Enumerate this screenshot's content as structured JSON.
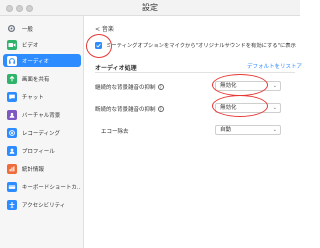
{
  "window": {
    "title": "設定"
  },
  "sidebar": {
    "items": [
      {
        "label": "一般",
        "icon": "gear-icon",
        "active": false
      },
      {
        "label": "ビデオ",
        "icon": "video-icon",
        "active": false
      },
      {
        "label": "オーディオ",
        "icon": "headphones-icon",
        "active": true
      },
      {
        "label": "画面を共有",
        "icon": "screen-share-icon",
        "active": false
      },
      {
        "label": "チャット",
        "icon": "chat-icon",
        "active": false
      },
      {
        "label": "バーチャル背景",
        "icon": "background-icon",
        "active": false
      },
      {
        "label": "レコーディング",
        "icon": "record-icon",
        "active": false
      },
      {
        "label": "プロフィール",
        "icon": "profile-icon",
        "active": false
      },
      {
        "label": "統計情報",
        "icon": "stats-icon",
        "active": false
      },
      {
        "label": "キーボードショートカ...",
        "icon": "keyboard-icon",
        "active": false
      },
      {
        "label": "アクセシビリティ",
        "icon": "accessibility-icon",
        "active": false
      }
    ]
  },
  "main": {
    "back_label": "< 音楽",
    "checkbox_label": "ミーティングオプションをマイクから\"オリジナルサウンドを有効にする\"に表示",
    "audio_processing_title": "オーディオ処理",
    "reset_label": "デフォルトをリストア",
    "rows": [
      {
        "label": "継続的な背景雑音の抑制",
        "value": "無効化"
      },
      {
        "label": "断続的な背景雑音の抑制",
        "value": "無効化"
      },
      {
        "label": "エコー除去",
        "value": "自動"
      }
    ]
  },
  "colors": {
    "accent": "#2d8cff",
    "annotation": "#e53935"
  }
}
